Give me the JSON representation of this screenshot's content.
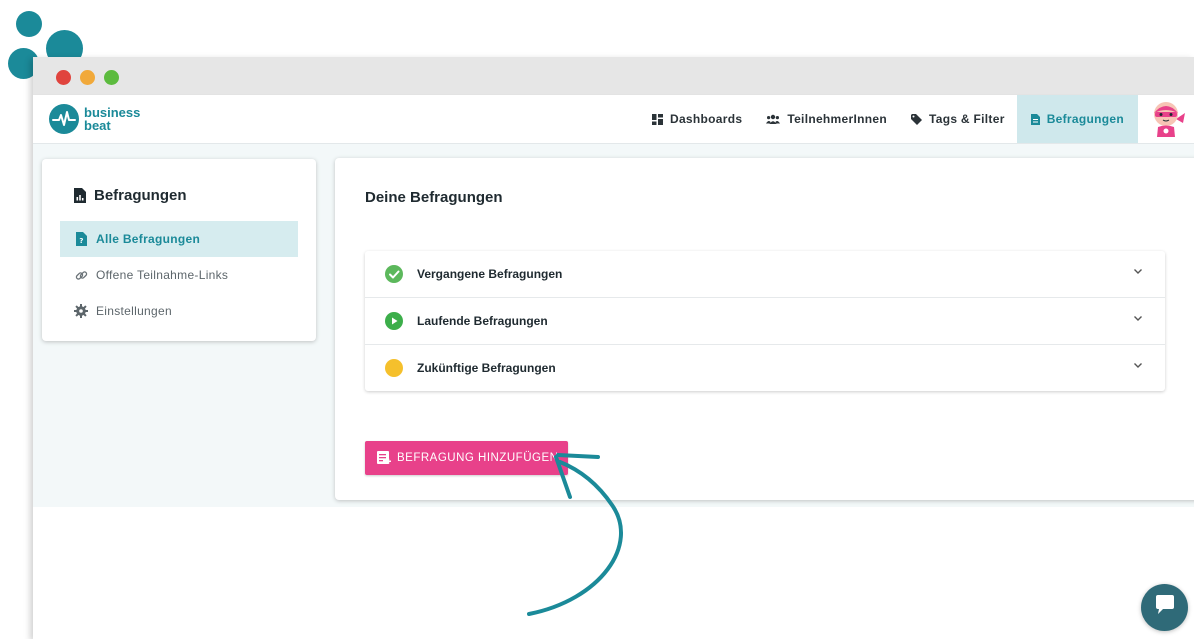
{
  "brand": {
    "name_line1": "business",
    "name_line2": "beat",
    "color": "#1b8a99",
    "accent": "#e8418a"
  },
  "navbar": {
    "items": [
      {
        "label": "Dashboards",
        "icon": "dashboard-icon"
      },
      {
        "label": "TeilnehmerInnen",
        "icon": "users-icon"
      },
      {
        "label": "Tags & Filter",
        "icon": "tag-icon"
      },
      {
        "label": "Befragungen",
        "icon": "document-icon",
        "active": true
      }
    ],
    "avatar_icon": "superhero-avatar-icon"
  },
  "sidebar": {
    "title": "Befragungen",
    "items": [
      {
        "label": "Alle Befragungen",
        "icon": "survey-document-icon",
        "active": true
      },
      {
        "label": "Offene Teilnahme-Links",
        "icon": "link-icon"
      },
      {
        "label": "Einstellungen",
        "icon": "gear-icon"
      }
    ]
  },
  "main": {
    "title": "Deine Befragungen",
    "accordion": [
      {
        "label": "Vergangene Befragungen",
        "status_icon": "check-circle-icon",
        "status_color": "#5cb85c"
      },
      {
        "label": "Laufende Befragungen",
        "status_icon": "play-circle-icon",
        "status_color": "#3cae4a"
      },
      {
        "label": "Zukünftige Befragungen",
        "status_icon": "yellow-circle-icon",
        "status_color": "#f5c02c"
      }
    ],
    "add_button": {
      "label": "BEFRAGUNG HINZUFÜGEN",
      "icon": "add-list-icon"
    }
  },
  "chat": {
    "icon": "chat-bubble-icon"
  }
}
